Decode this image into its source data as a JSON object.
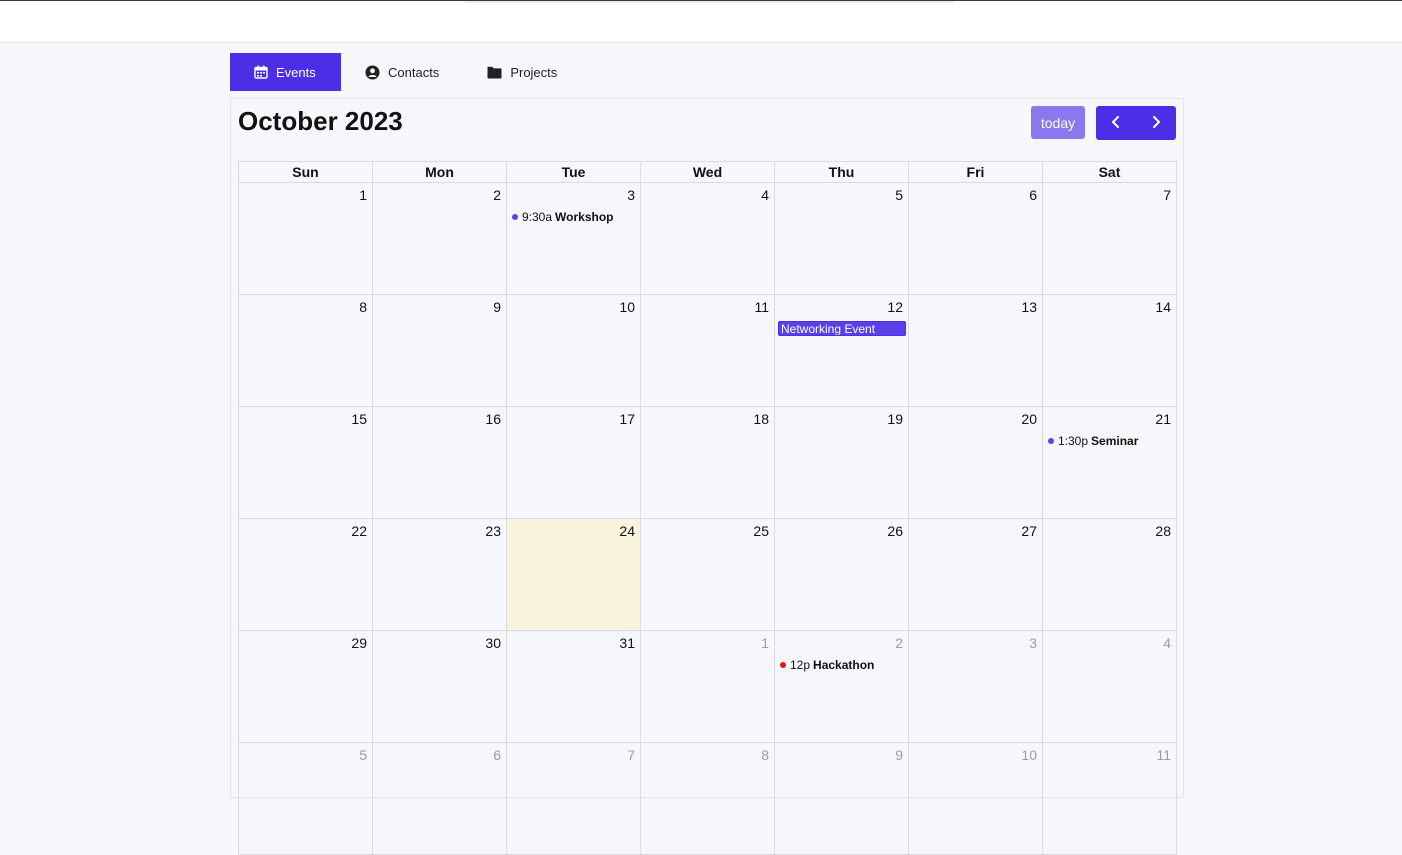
{
  "tabs": [
    {
      "label": "Events",
      "icon": "calendar-icon",
      "active": true
    },
    {
      "label": "Contacts",
      "icon": "user-circle-icon",
      "active": false
    },
    {
      "label": "Projects",
      "icon": "folder-icon",
      "active": false
    }
  ],
  "calendar": {
    "title": "October 2023",
    "today_label": "today",
    "weekdays": [
      "Sun",
      "Mon",
      "Tue",
      "Wed",
      "Thu",
      "Fri",
      "Sat"
    ],
    "weeks": [
      [
        {
          "n": "1"
        },
        {
          "n": "2"
        },
        {
          "n": "3",
          "events": [
            {
              "kind": "dot",
              "time": "9:30a",
              "title": "Workshop",
              "color": "#5b3fe8"
            }
          ]
        },
        {
          "n": "4"
        },
        {
          "n": "5"
        },
        {
          "n": "6"
        },
        {
          "n": "7"
        }
      ],
      [
        {
          "n": "8"
        },
        {
          "n": "9"
        },
        {
          "n": "10"
        },
        {
          "n": "11"
        },
        {
          "n": "12",
          "events": [
            {
              "kind": "block",
              "title": "Networking Event",
              "color": "#5b3fe8"
            }
          ]
        },
        {
          "n": "13"
        },
        {
          "n": "14"
        }
      ],
      [
        {
          "n": "15"
        },
        {
          "n": "16"
        },
        {
          "n": "17"
        },
        {
          "n": "18"
        },
        {
          "n": "19"
        },
        {
          "n": "20"
        },
        {
          "n": "21",
          "events": [
            {
              "kind": "dot",
              "time": "1:30p",
              "title": "Seminar",
              "color": "#5b3fe8"
            }
          ]
        }
      ],
      [
        {
          "n": "22"
        },
        {
          "n": "23"
        },
        {
          "n": "24",
          "today": true
        },
        {
          "n": "25"
        },
        {
          "n": "26"
        },
        {
          "n": "27"
        },
        {
          "n": "28"
        }
      ],
      [
        {
          "n": "29"
        },
        {
          "n": "30"
        },
        {
          "n": "31"
        },
        {
          "n": "1",
          "other": true
        },
        {
          "n": "2",
          "other": true,
          "events": [
            {
              "kind": "dot",
              "time": "12p",
              "title": "Hackathon",
              "color": "#e0161b"
            }
          ]
        },
        {
          "n": "3",
          "other": true
        },
        {
          "n": "4",
          "other": true
        }
      ],
      [
        {
          "n": "5",
          "other": true
        },
        {
          "n": "6",
          "other": true
        },
        {
          "n": "7",
          "other": true
        },
        {
          "n": "8",
          "other": true
        },
        {
          "n": "9",
          "other": true
        },
        {
          "n": "10",
          "other": true
        },
        {
          "n": "11",
          "other": true
        }
      ]
    ]
  },
  "colors": {
    "accent": "#4b2ee6",
    "today_button": "#8a78ee",
    "today_cell": "#f8f4db"
  }
}
